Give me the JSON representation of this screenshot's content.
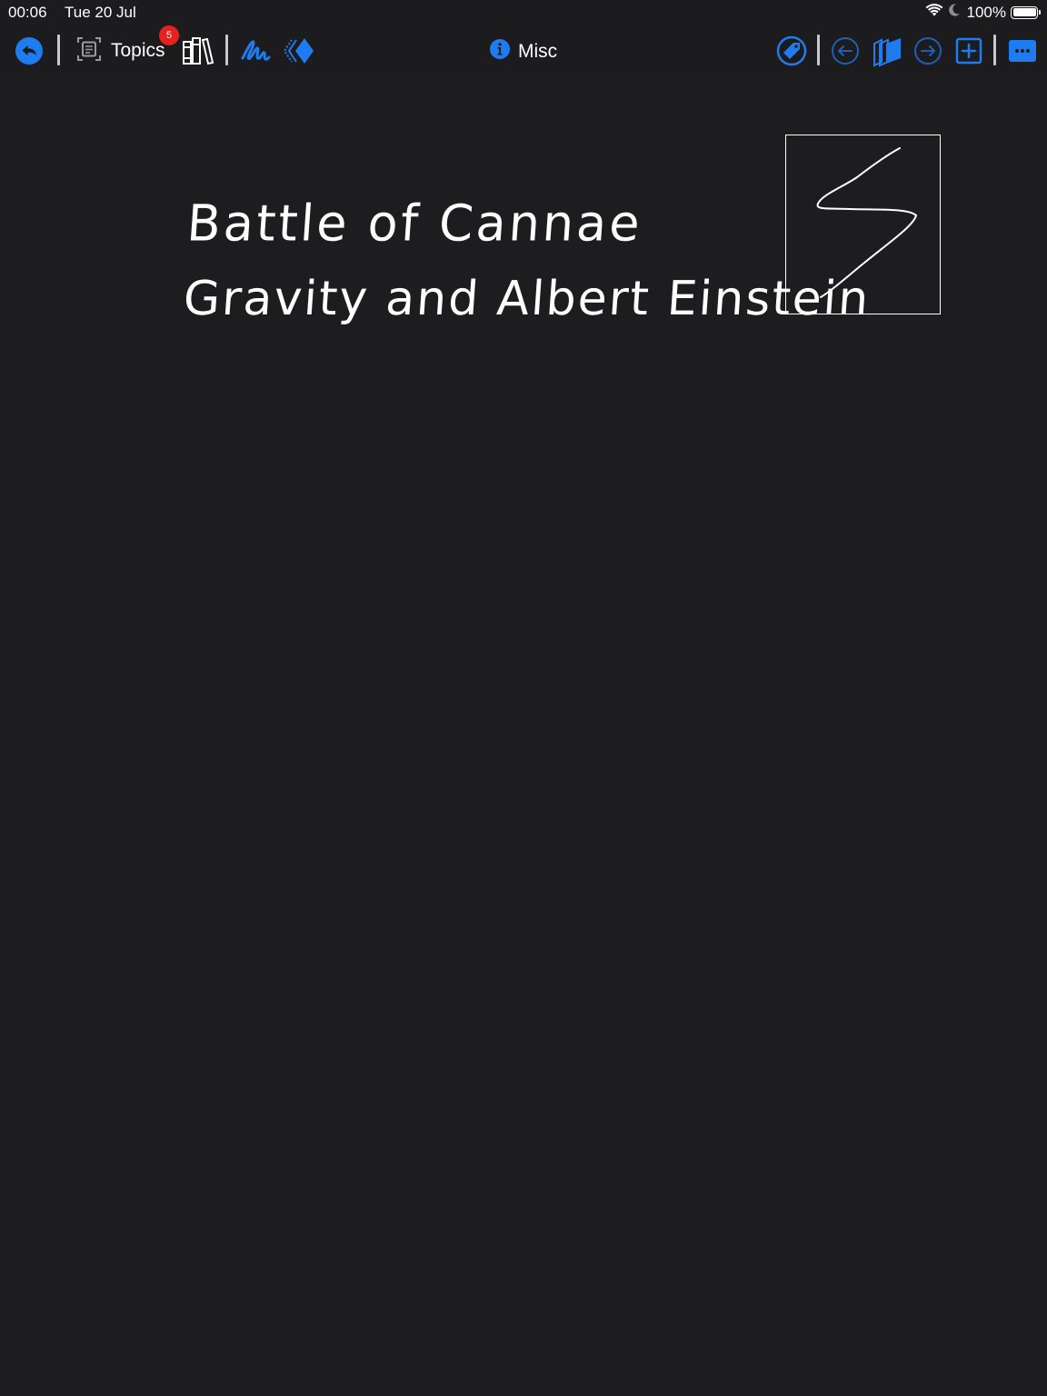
{
  "status_bar": {
    "time": "00:06",
    "date": "Tue 20 Jul",
    "battery_percent": "100%",
    "icons": [
      "wifi-icon",
      "moon-icon",
      "battery-icon"
    ]
  },
  "toolbar": {
    "back_icon": "back-arrow-icon",
    "topics_icon": "topics-icon",
    "topics_label": "Topics",
    "topics_badge": "5",
    "library_icon": "books-icon",
    "handwriting_icon": "handwriting-icon",
    "sidebar_icon": "collapse-panel-icon",
    "title_icon": "info-icon",
    "title": "Misc",
    "right_icons": [
      "tag-icon",
      "previous-page-icon",
      "pages-icon",
      "next-page-icon",
      "add-page-icon",
      "more-icon"
    ]
  },
  "canvas": {
    "handwritten_lines": [
      "Battle of Cannae",
      "Gravity and Albert Einstein"
    ],
    "drawing": "zigzag sketch in box"
  },
  "colors": {
    "background": "#1d1d1f",
    "toolbar": "#1c1c1e",
    "accent": "#1e7bf0",
    "badge": "#e5201f",
    "ink": "#ffffff"
  }
}
